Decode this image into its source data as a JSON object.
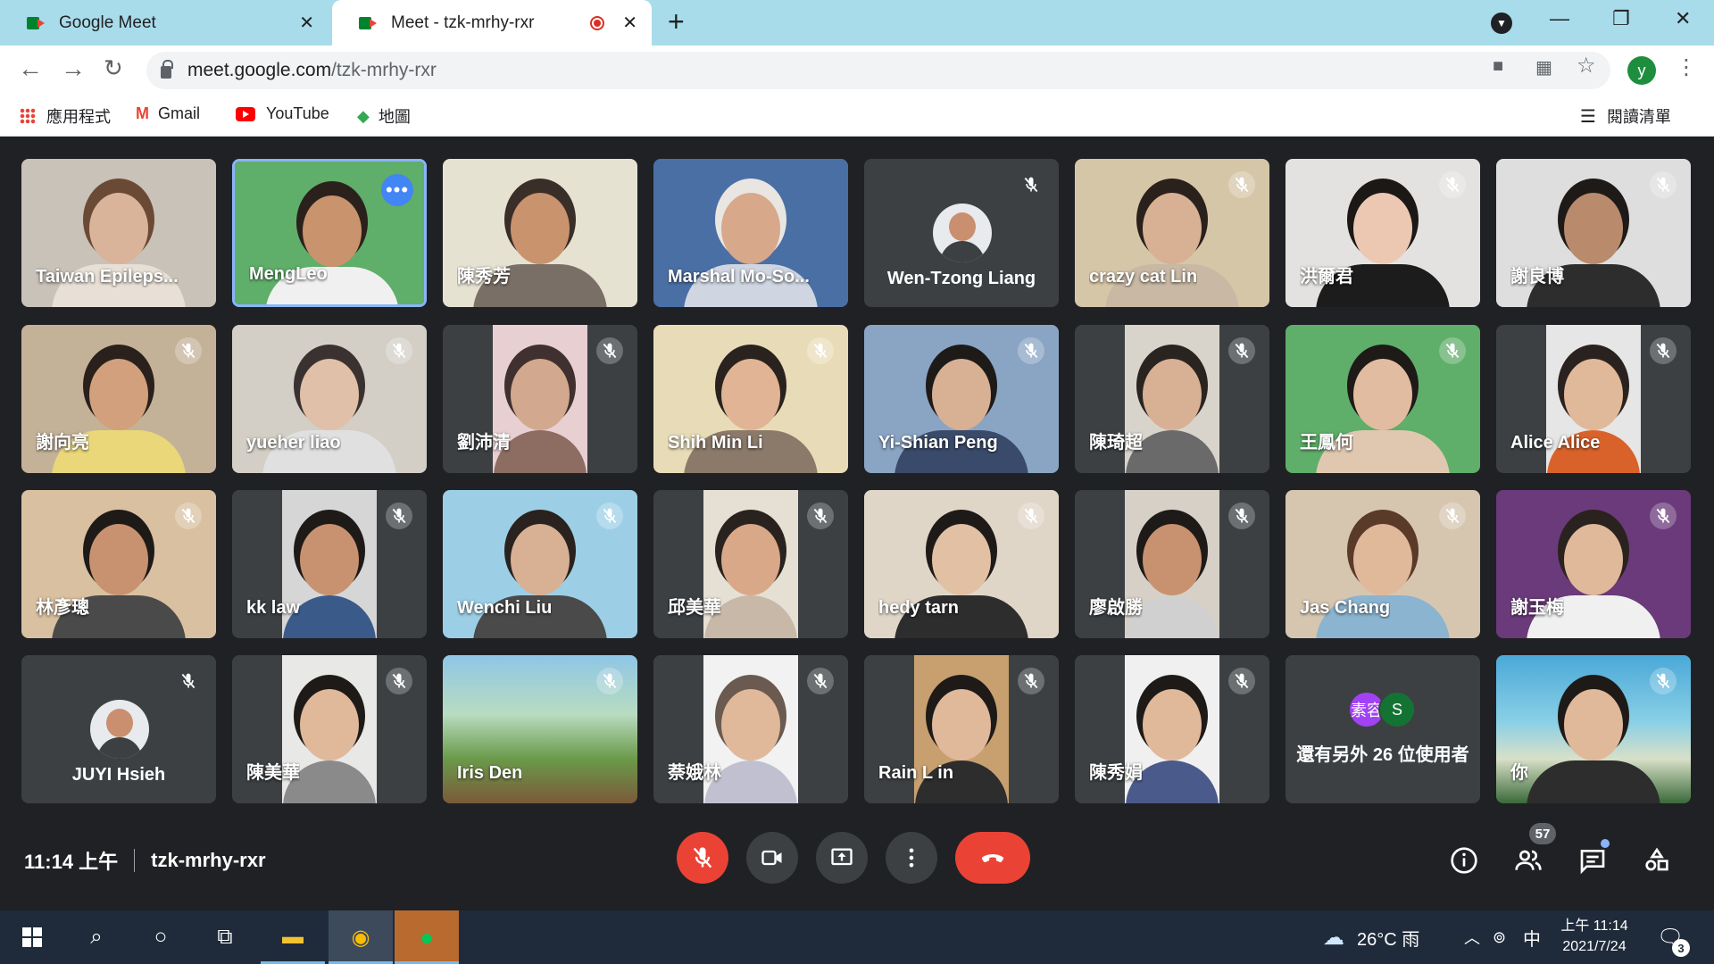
{
  "browser": {
    "tabs": [
      {
        "title": "Google Meet",
        "close": "✕"
      },
      {
        "title": "Meet - tzk-mrhy-rxr",
        "close": "✕"
      }
    ],
    "new_tab": "+",
    "url_host": "meet.google.com",
    "url_path": "/tzk-mrhy-rxr",
    "profile_initial": "y",
    "window_controls": {
      "minimize": "—",
      "restore": "❐",
      "close": "✕"
    }
  },
  "bookmarks": [
    {
      "label": "應用程式",
      "icon": "apps-grid-icon"
    },
    {
      "label": "Gmail",
      "icon": "gmail-icon"
    },
    {
      "label": "YouTube",
      "icon": "youtube-icon"
    },
    {
      "label": "地圖",
      "icon": "maps-icon"
    }
  ],
  "reading_list": "閱讀清單",
  "participants": [
    {
      "name": "Taiwan Epileps...",
      "muted": false,
      "bg": "#c9c2b8",
      "skin": "#d9b49a",
      "hair": "#6b4a35",
      "shirt": "#e8e0d6"
    },
    {
      "name": "MengLeo",
      "muted": false,
      "bg": "#5fae6a",
      "skin": "#c9936e",
      "hair": "#2b211c",
      "shirt": "#f0f0f0",
      "highlight": true,
      "more": true
    },
    {
      "name": "陳秀芳",
      "muted": false,
      "bg": "#e6e2d2",
      "skin": "#c9936e",
      "hair": "#3a2e28",
      "shirt": "#7a6f66"
    },
    {
      "name": "Marshal Mo-So...",
      "muted": false,
      "bg": "#4a6fa5",
      "skin": "#d8a88a",
      "hair": "#e9e6e2",
      "shirt": "#cfd6e2"
    },
    {
      "name": "Wen-Tzong Liang",
      "muted": true,
      "avatar": true
    },
    {
      "name": "crazy cat Lin",
      "muted": true,
      "bg": "#d6c6a8",
      "skin": "#d8b194",
      "hair": "#2b211c",
      "shirt": "#c8b8a4"
    },
    {
      "name": "洪爾君",
      "muted": true,
      "bg": "#e4e2e0",
      "skin": "#ecc8b2",
      "hair": "#1c1816",
      "shirt": "#1c1c1c"
    },
    {
      "name": "謝良博",
      "muted": true,
      "bg": "#dedede",
      "skin": "#b98a6c",
      "hair": "#1e1a18",
      "shirt": "#2d2d2d"
    },
    {
      "name": "謝向亮",
      "muted": true,
      "bg": "#c4b298",
      "skin": "#d2a07c",
      "hair": "#2a201c",
      "shirt": "#e9d779"
    },
    {
      "name": "yueher liao",
      "muted": true,
      "bg": "#d3cfc6",
      "skin": "#e0c0a8",
      "hair": "#3a3230",
      "shirt": "#e0e0e0"
    },
    {
      "name": "劉沛清",
      "muted": true,
      "bg": "#e8d0d2",
      "skin": "#d2a98e",
      "hair": "#403030",
      "shirt": "#8d6c62",
      "narrow": true
    },
    {
      "name": "Shih Min Li",
      "muted": true,
      "bg": "#e8dcb8",
      "skin": "#e0b494",
      "hair": "#2a221e",
      "shirt": "#8b7a6a"
    },
    {
      "name": "Yi-Shian Peng",
      "muted": true,
      "bg": "#8aa4c4",
      "skin": "#d8b094",
      "hair": "#1e1a18",
      "shirt": "#3a4a6a"
    },
    {
      "name": "陳琦超",
      "muted": true,
      "bg": "#d8d4cc",
      "skin": "#d8b094",
      "hair": "#2a2420",
      "shirt": "#6a6a6a",
      "narrow": true
    },
    {
      "name": "王鳳何",
      "muted": true,
      "bg": "#5fae6a",
      "skin": "#e2bca0",
      "hair": "#1e1a18",
      "shirt": "#e0c8b0"
    },
    {
      "name": "Alice Alice",
      "muted": true,
      "bg": "#e6e6e6",
      "skin": "#e0b89a",
      "hair": "#2a221e",
      "shirt": "#d9622b",
      "narrow": true
    },
    {
      "name": "林彥璁",
      "muted": true,
      "bg": "#d8c0a0",
      "skin": "#c89270",
      "hair": "#1e1a18",
      "shirt": "#4a4a4a"
    },
    {
      "name": "kk law",
      "muted": true,
      "bg": "#d6d6d6",
      "skin": "#c89270",
      "hair": "#1e1a18",
      "shirt": "#3a5a8a",
      "narrow": true
    },
    {
      "name": "Wenchi Liu",
      "muted": true,
      "bg": "#9ccfe6",
      "skin": "#d8b094",
      "hair": "#2a221e",
      "shirt": "#4a4a4a"
    },
    {
      "name": "邱美華",
      "muted": true,
      "bg": "#e6e0d4",
      "skin": "#d8a888",
      "hair": "#2a221e",
      "shirt": "#c8b8a8",
      "narrow": true
    },
    {
      "name": "hedy tarn",
      "muted": true,
      "bg": "#e0d6c8",
      "skin": "#e2c0a4",
      "hair": "#1e1a18",
      "shirt": "#2d2d2d"
    },
    {
      "name": "廖啟勝",
      "muted": true,
      "bg": "#d6d0c6",
      "skin": "#c89270",
      "hair": "#1e1a18",
      "shirt": "#d0d0d0",
      "narrow": true
    },
    {
      "name": "Jas Chang",
      "muted": true,
      "bg": "#d6c6b0",
      "skin": "#e0b89a",
      "hair": "#5a3a28",
      "shirt": "#8ab4d0"
    },
    {
      "name": "謝玉梅",
      "muted": true,
      "bg": "#6a3a7a",
      "skin": "#e0b89a",
      "hair": "#2a221e",
      "shirt": "#f0f0f0"
    },
    {
      "name": "JUYI Hsieh",
      "muted": true,
      "avatar": true
    },
    {
      "name": "陳美華",
      "muted": true,
      "bg": "#e8e8e6",
      "skin": "#e0b89a",
      "hair": "#1e1a18",
      "shirt": "#8a8a8a",
      "narrow": true
    },
    {
      "name": "Iris Den",
      "muted": true,
      "bg": "#7ab06a",
      "skin": "#a0784c",
      "hair": "#5a4a30",
      "shirt": "#6a8a4a",
      "scenery": true
    },
    {
      "name": "萘娥林",
      "muted": true,
      "bg": "#f2f2f2",
      "skin": "#e0b89a",
      "hair": "#6a5a50",
      "shirt": "#c0c0d0",
      "narrow": true
    },
    {
      "name": "Rain L in",
      "muted": true,
      "bg": "#c8a070",
      "skin": "#e0b89a",
      "hair": "#1e1a18",
      "shirt": "#2d2d2d",
      "narrow": true
    },
    {
      "name": "陳秀娟",
      "muted": true,
      "bg": "#f0f0f0",
      "skin": "#e0b89a",
      "hair": "#1e1a18",
      "shirt": "#4a5a8a",
      "narrow": true
    },
    {
      "name": "還有另外 26 位使用者",
      "others": true,
      "initials": [
        "素容",
        "S"
      ]
    },
    {
      "name": "你",
      "muted": true,
      "bg": "#3aa0c8",
      "skin": "#e0b89a",
      "hair": "#1e1a18",
      "shirt": "#2d2d2d",
      "self": true
    }
  ],
  "meeting": {
    "time": "11:14 上午",
    "code": "tzk-mrhy-rxr",
    "participant_count": "57"
  },
  "colors": {
    "mute_red": "#ea4335",
    "control_gray": "#3c4043",
    "accent_blue": "#8ab4f8"
  },
  "taskbar": {
    "weather": "26°C 雨",
    "ime": "中",
    "time": "上午 11:14",
    "date": "2021/7/24",
    "notifications": "3"
  }
}
